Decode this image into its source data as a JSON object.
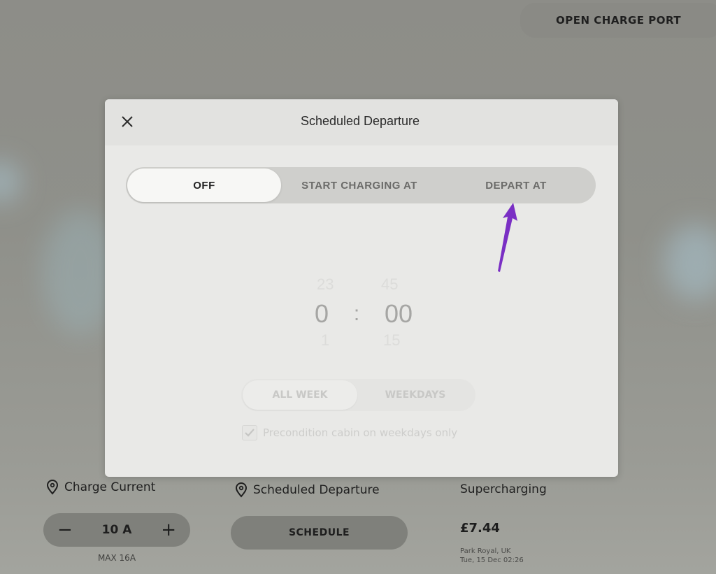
{
  "top_bar": {
    "open_charge_port_label": "OPEN CHARGE PORT"
  },
  "modal": {
    "title": "Scheduled Departure",
    "close_icon": "close-icon",
    "mode_options": [
      {
        "label": "OFF",
        "selected": true
      },
      {
        "label": "START CHARGING AT",
        "selected": false
      },
      {
        "label": "DEPART AT",
        "selected": false
      }
    ],
    "time_picker": {
      "hour_prev": "23",
      "hour": "0",
      "hour_next": "1",
      "separator": ":",
      "minute_prev": "45",
      "minute": "00",
      "minute_next": "15",
      "disabled": true
    },
    "day_options": [
      {
        "label": "ALL WEEK",
        "selected": true
      },
      {
        "label": "WEEKDAYS",
        "selected": false
      }
    ],
    "precondition": {
      "label": "Precondition cabin on weekdays only",
      "checked": true,
      "disabled": true
    }
  },
  "annotation": {
    "arrow_color": "#7a2fc4",
    "points_to": "DEPART AT"
  },
  "charge_current": {
    "title": "Charge Current",
    "icon": "location-pin-icon",
    "decrement_label": "−",
    "value": "10 A",
    "increment_label": "+",
    "max_label": "MAX 16A"
  },
  "scheduled_departure": {
    "title": "Scheduled Departure",
    "icon": "location-pin-icon",
    "button_label": "SCHEDULE"
  },
  "supercharging": {
    "title": "Supercharging",
    "price": "£7.44",
    "location": "Park Royal, UK",
    "datetime": "Tue, 15 Dec 02:26"
  }
}
